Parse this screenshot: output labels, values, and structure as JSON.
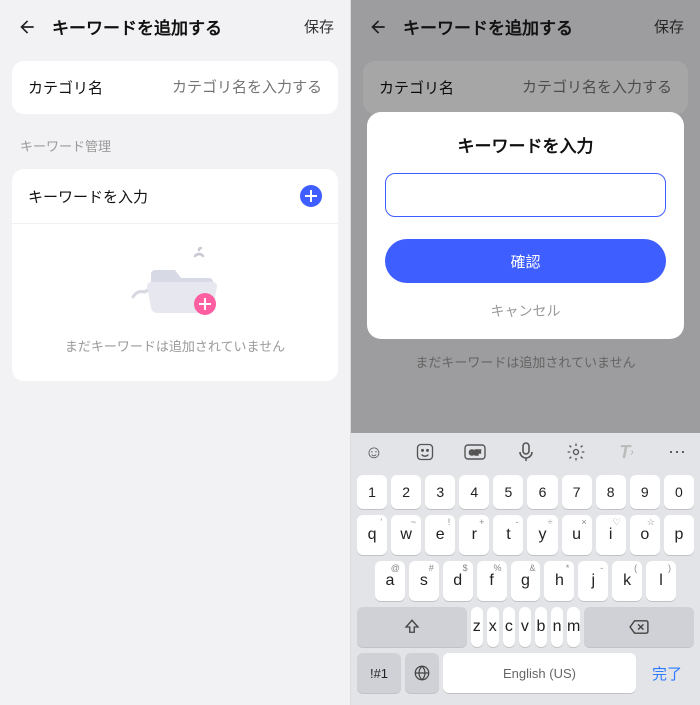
{
  "left": {
    "header": {
      "title": "キーワードを追加する",
      "save": "保存"
    },
    "category": {
      "label": "カテゴリ名",
      "placeholder": "カテゴリ名を入力する"
    },
    "section": "キーワード管理",
    "kwRow": {
      "label": "キーワードを入力"
    },
    "empty": "まだキーワードは追加されていません"
  },
  "right": {
    "header": {
      "title": "キーワードを追加する",
      "save": "保存"
    },
    "category": {
      "label": "カテゴリ名",
      "placeholder": "カテゴリ名を入力する"
    },
    "empty": "まだキーワードは追加されていません",
    "dialog": {
      "title": "キーワードを入力",
      "confirm": "確認",
      "cancel": "キャンセル"
    }
  },
  "keyboard": {
    "row1": [
      "1",
      "2",
      "3",
      "4",
      "5",
      "6",
      "7",
      "8",
      "9",
      "0"
    ],
    "row2": [
      {
        "k": "q",
        "s": "'"
      },
      {
        "k": "w",
        "s": "~"
      },
      {
        "k": "e",
        "s": "!"
      },
      {
        "k": "r",
        "s": "+"
      },
      {
        "k": "t",
        "s": "-"
      },
      {
        "k": "y",
        "s": "÷"
      },
      {
        "k": "u",
        "s": "×"
      },
      {
        "k": "i",
        "s": "♡"
      },
      {
        "k": "o",
        "s": "☆"
      },
      {
        "k": "p",
        "s": ""
      }
    ],
    "row3": [
      {
        "k": "a",
        "s": "@"
      },
      {
        "k": "s",
        "s": "#"
      },
      {
        "k": "d",
        "s": "$"
      },
      {
        "k": "f",
        "s": "%"
      },
      {
        "k": "g",
        "s": "&"
      },
      {
        "k": "h",
        "s": "*"
      },
      {
        "k": "j",
        "s": "-"
      },
      {
        "k": "k",
        "s": "("
      },
      {
        "k": "l",
        "s": ")"
      }
    ],
    "row4": [
      "z",
      "x",
      "c",
      "v",
      "b",
      "n",
      "m"
    ],
    "mode": "!#1",
    "space": "English (US)",
    "enter": "完了"
  }
}
